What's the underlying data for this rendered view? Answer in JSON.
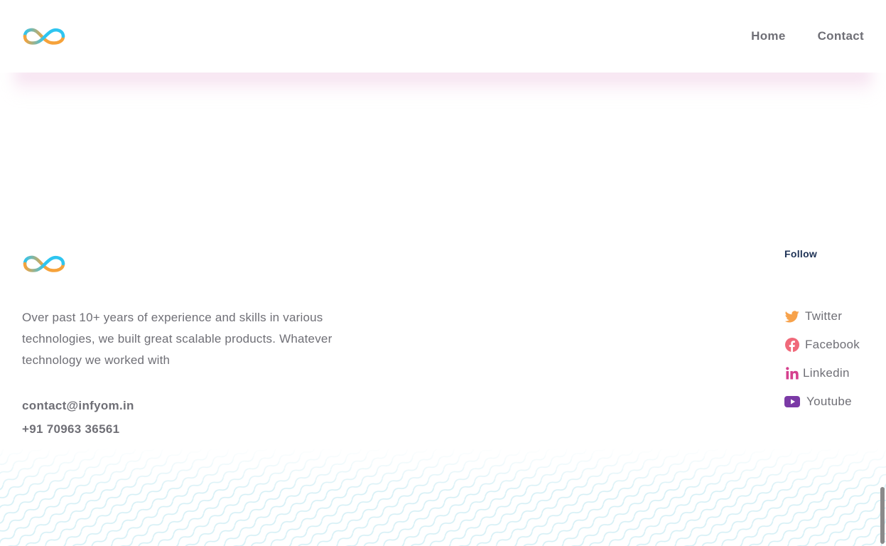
{
  "header": {
    "nav": [
      {
        "label": "Home"
      },
      {
        "label": "Contact"
      }
    ]
  },
  "footer": {
    "about": "Over past 10+ years of experience and skills in various technologies, we built great scalable products. Whatever technology we worked with",
    "email": "contact@infyom.in",
    "phone": "+91 70963 36561",
    "follow_heading": "Follow",
    "social": [
      {
        "label": "Twitter",
        "icon": "twitter-icon",
        "color": "#f7a24b"
      },
      {
        "label": "Facebook",
        "icon": "facebook-icon",
        "color": "#f0697a"
      },
      {
        "label": "Linkedin",
        "icon": "linkedin-icon",
        "color": "#d5408e"
      },
      {
        "label": "Youtube",
        "icon": "youtube-icon",
        "color": "#7b3aa6"
      }
    ]
  },
  "colors": {
    "logo_orange": "#f6a23a",
    "logo_blue": "#2ec5f0",
    "text": "#6f6f76",
    "heading": "#1e3255"
  }
}
